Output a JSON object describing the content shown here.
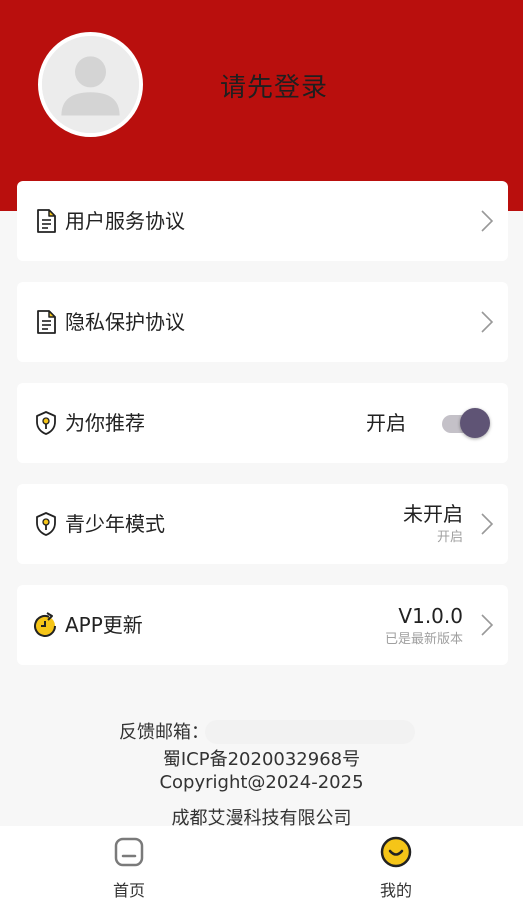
{
  "header": {
    "login_prompt": "请先登录",
    "brand_color": "#b90f0d"
  },
  "menu": {
    "user_agreement": {
      "label": "用户服务协议",
      "icon": "document-icon"
    },
    "privacy_policy": {
      "label": "隐私保护协议",
      "icon": "document-icon"
    },
    "recommend": {
      "label": "为你推荐",
      "icon": "shield-icon",
      "state_label": "开启",
      "enabled": true
    },
    "teen_mode": {
      "label": "青少年模式",
      "icon": "shield-icon",
      "status": "未开启",
      "action": "开启"
    },
    "app_update": {
      "label": "APP更新",
      "icon": "update-icon",
      "version": "V1.0.0",
      "status": "已是最新版本"
    }
  },
  "footer": {
    "feedback_label": "反馈邮箱：",
    "icp": "蜀ICP备2020032968号",
    "copyright": "Copyright@2024-2025",
    "company": "成都艾漫科技有限公司"
  },
  "tabbar": {
    "home": {
      "label": "首页",
      "icon": "home-icon"
    },
    "mine": {
      "label": "我的",
      "icon": "smile-icon",
      "active_color": "#f5c518"
    }
  }
}
